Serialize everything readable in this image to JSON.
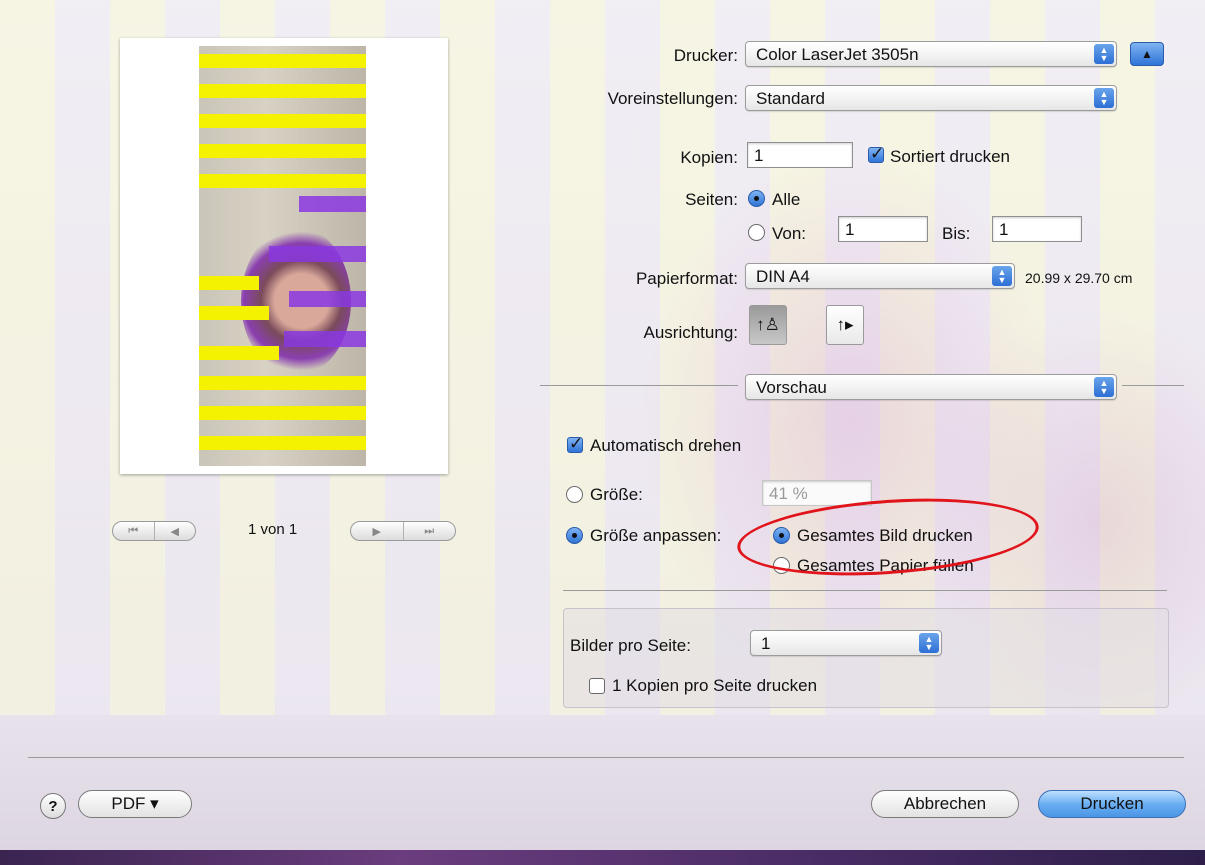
{
  "preview": {
    "page_indicator": "1 von 1"
  },
  "printer": {
    "label": "Drucker:",
    "value": "Color LaserJet 3505n"
  },
  "presets": {
    "label": "Voreinstellungen:",
    "value": "Standard"
  },
  "copies": {
    "label": "Kopien:",
    "value": "1",
    "collate_label": "Sortiert drucken",
    "collate_checked": true
  },
  "pages": {
    "label": "Seiten:",
    "all_label": "Alle",
    "from_label": "Von:",
    "from_value": "1",
    "to_label": "Bis:",
    "to_value": "1",
    "selected": "all"
  },
  "paper": {
    "label": "Papierformat:",
    "value": "DIN A4",
    "size_text": "20.99 x 29.70 cm"
  },
  "orientation": {
    "label": "Ausrichtung:",
    "portrait_icon": "portrait-orientation-icon",
    "landscape_icon": "landscape-orientation-icon",
    "selected": "portrait"
  },
  "section": {
    "value": "Vorschau"
  },
  "preview_options": {
    "auto_rotate_label": "Automatisch drehen",
    "auto_rotate_checked": true,
    "scale_label": "Größe:",
    "scale_value": "41 %",
    "fit_label": "Größe anpassen:",
    "fit_selected": true,
    "print_entire_label": "Gesamtes Bild drucken",
    "fill_paper_label": "Gesamtes Papier füllen",
    "fit_mode": "entire"
  },
  "layout": {
    "images_per_page_label": "Bilder pro Seite:",
    "images_per_page_value": "1",
    "copies_per_page_label": "1 Kopien pro Seite drucken",
    "copies_per_page_checked": false
  },
  "footer": {
    "help_symbol": "?",
    "pdf_label": "PDF ▾",
    "cancel_label": "Abbrechen",
    "print_label": "Drucken"
  },
  "colors": {
    "accent": "#2f74d8",
    "annotation": "#e0141a",
    "stripe": "#f4f200"
  }
}
